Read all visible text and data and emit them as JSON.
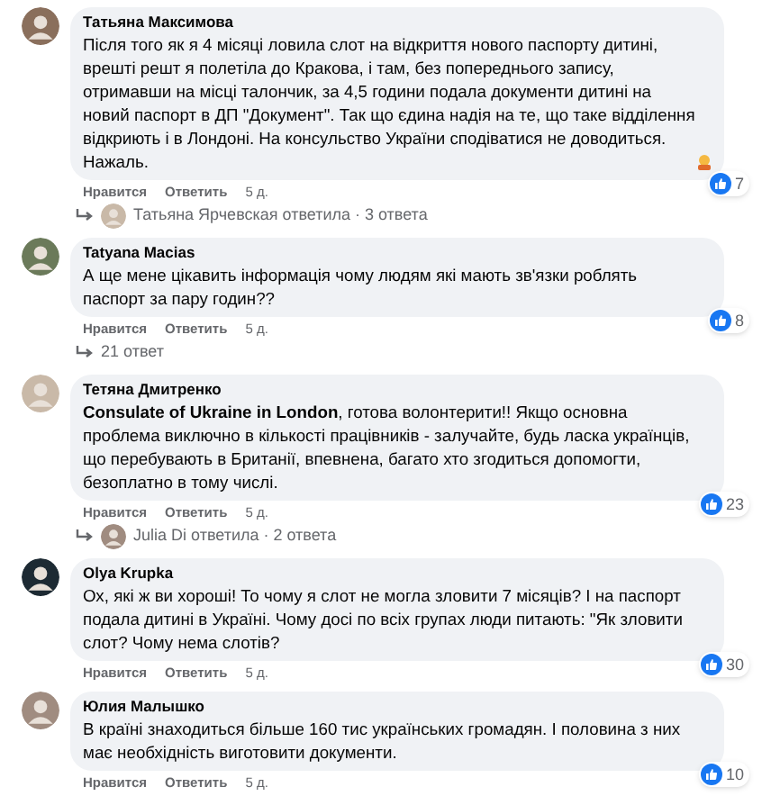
{
  "comments": [
    {
      "author": "Татьяна Максимова",
      "text": "Після того як я 4 місяці ловила слот на відкриття нового паспорту дитині, врешті решт я полетіла до Кракова, і там, без попереднього запису, отримавши на місці талончик, за 4,5 години подала документи дитині на новий паспорт в ДП \"Документ\". Так що єдина надія на те, що таке відділення відкриють і в Лондоні. На консульство України сподіватися не доводиться. Нажаль.",
      "emoji": true,
      "like": "Нравится",
      "reply": "Ответить",
      "time": "5 д.",
      "reactions": "7",
      "replies": {
        "text": "Татьяна Ярчевская ответила · 3 ответа",
        "has_avatar": true
      }
    },
    {
      "author": "Tatyana Macias",
      "text": "А ще мене цікавить інформація чому людям які мають зв'язки роблять паспорт за пару годин??",
      "emoji": false,
      "like": "Нравится",
      "reply": "Ответить",
      "time": "5 д.",
      "reactions": "8",
      "replies": {
        "text": "21 ответ",
        "has_avatar": false
      }
    },
    {
      "author": "Тетяна Дмитренко",
      "text": "**Consulate of Ukraine in London**, готова волонтерити!! Якщо основна проблема виключно в кількості працівників - залучайте, будь ласка українців, що перебувають в Британії, впевнена, багато хто згодиться допомогти, безоплатно в тому числі.",
      "emoji": false,
      "like": "Нравится",
      "reply": "Ответить",
      "time": "5 д.",
      "reactions": "23",
      "replies": {
        "text": "Julia Di ответила · 2 ответа",
        "has_avatar": true
      }
    },
    {
      "author": "Olya Krupka",
      "text": "Ох, які ж ви хороші! То чому я слот не могла зловити 7 місяців? І на паспорт подала дитині в Україні. Чому досі по всіх групах люди питають: \"Як зловити слот? Чому нема слотів?",
      "emoji": false,
      "like": "Нравится",
      "reply": "Ответить",
      "time": "5 д.",
      "reactions": "30"
    },
    {
      "author": "Юлия Малышко",
      "text": "В країні знаходиться більше 160 тис українських громадян. І половина з них має необхідність виготовити документи.",
      "emoji": false,
      "like": "Нравится",
      "reply": "Ответить",
      "time": "5 д.",
      "reactions": "10"
    }
  ]
}
